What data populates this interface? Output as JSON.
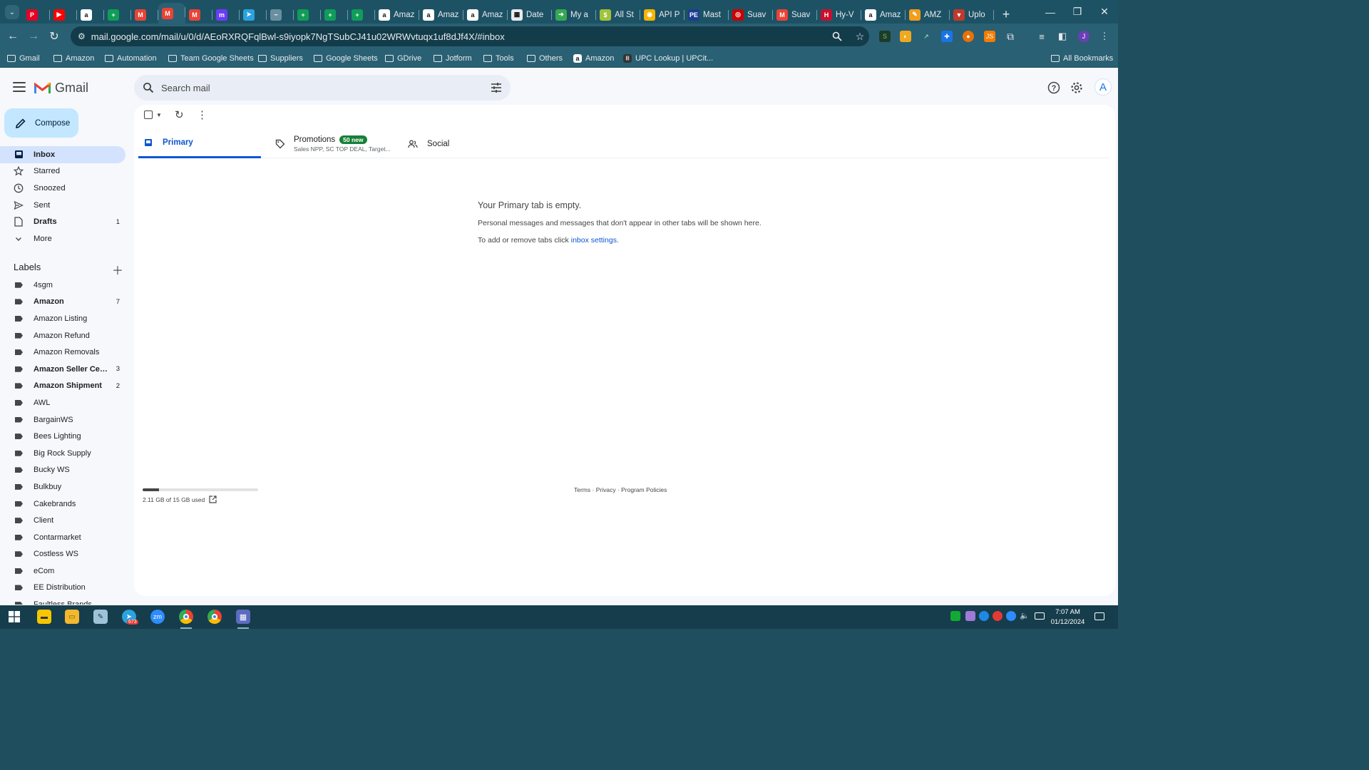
{
  "browser": {
    "tabs": [
      {
        "title": "",
        "icon": "pinterest-icon",
        "color": "#e60023",
        "glyph": "P"
      },
      {
        "title": "",
        "icon": "youtube-icon",
        "color": "#ff0000",
        "glyph": "▶"
      },
      {
        "title": "",
        "icon": "amazon-icon",
        "color": "#ffffff",
        "glyph": "a"
      },
      {
        "title": "",
        "icon": "google-sheets-icon",
        "color": "#0f9d58",
        "glyph": "+"
      },
      {
        "title": "",
        "icon": "gmail-icon",
        "color": "#ea4335",
        "glyph": "M"
      },
      {
        "title": "",
        "icon": "gmail-icon",
        "color": "#ea4335",
        "glyph": "M",
        "active": true
      },
      {
        "title": "",
        "icon": "gmail-icon",
        "color": "#ea4335",
        "glyph": "M"
      },
      {
        "title": "",
        "icon": "messenger-icon",
        "color": "#6b3cf7",
        "glyph": "m"
      },
      {
        "title": "",
        "icon": "telegram-icon",
        "color": "#2aa3df",
        "glyph": "➤"
      },
      {
        "title": "",
        "icon": "analytics-icon",
        "color": "#6b8fa0",
        "glyph": "~"
      },
      {
        "title": "",
        "icon": "google-sheets-icon",
        "color": "#0f9d58",
        "glyph": "+"
      },
      {
        "title": "",
        "icon": "google-sheets-icon",
        "color": "#0f9d58",
        "glyph": "+"
      },
      {
        "title": "",
        "icon": "google-sheets-icon",
        "color": "#0f9d58",
        "glyph": "+"
      },
      {
        "title": "Amaz",
        "icon": "amazon-icon",
        "color": "#ffffff",
        "glyph": "a"
      },
      {
        "title": "Amaz",
        "icon": "amazon-icon",
        "color": "#ffffff",
        "glyph": "a"
      },
      {
        "title": "Amaz",
        "icon": "amazon-icon",
        "color": "#ffffff",
        "glyph": "a"
      },
      {
        "title": "Date",
        "icon": "calendar-grid-icon",
        "color": "#e8eaed",
        "glyph": "▦"
      },
      {
        "title": "My a",
        "icon": "arrow-icon",
        "color": "#34a853",
        "glyph": "➔"
      },
      {
        "title": "All St",
        "icon": "store-icon",
        "color": "#9fc33b",
        "glyph": "$"
      },
      {
        "title": "API P",
        "icon": "api-icon",
        "color": "#f6b400",
        "glyph": "◉"
      },
      {
        "title": "Mast",
        "icon": "pe-icon",
        "color": "#1a3d8f",
        "glyph": "PE"
      },
      {
        "title": "Suav",
        "icon": "target-icon",
        "color": "#cc0000",
        "glyph": "◎"
      },
      {
        "title": "Suav",
        "icon": "gmail-icon",
        "color": "#ea4335",
        "glyph": "M"
      },
      {
        "title": "Hy-V",
        "icon": "hyvee-icon",
        "color": "#c8102e",
        "glyph": "H"
      },
      {
        "title": "Amaz",
        "icon": "amazon-icon",
        "color": "#ffffff",
        "glyph": "a"
      },
      {
        "title": "AMZ",
        "icon": "feather-icon",
        "color": "#f29d1b",
        "glyph": "✎"
      },
      {
        "title": "Uplo",
        "icon": "upload-icon",
        "color": "#c0392b",
        "glyph": "▼"
      }
    ],
    "url": "mail.google.com/mail/u/0/d/AEoRXRQFqlBwl-s9iyopk7NgTSubCJ41u02WRWvtuqx1uf8dJf4X/#inbox",
    "bookmarks": [
      {
        "label": "Gmail",
        "icon": "folder-icon"
      },
      {
        "label": "Amazon",
        "icon": "folder-icon"
      },
      {
        "label": "Automation",
        "icon": "folder-icon"
      },
      {
        "label": "Team Google Sheets",
        "icon": "folder-icon"
      },
      {
        "label": "Suppliers",
        "icon": "folder-icon"
      },
      {
        "label": "Google Sheets",
        "icon": "folder-icon"
      },
      {
        "label": "GDrive",
        "icon": "folder-icon"
      },
      {
        "label": "Jotform",
        "icon": "folder-icon"
      },
      {
        "label": "Tools",
        "icon": "folder-icon"
      },
      {
        "label": "Others",
        "icon": "folder-icon"
      },
      {
        "label": "Amazon",
        "icon": "amazon-icon"
      },
      {
        "label": "UPC Lookup | UPCit...",
        "icon": "barcode-icon"
      }
    ],
    "all_bookmarks": "All Bookmarks",
    "profile_initial": "J"
  },
  "gmail": {
    "product_name": "Gmail",
    "search_placeholder": "Search mail",
    "compose_label": "Compose",
    "avatar_initial": "A",
    "nav": [
      {
        "label": "Inbox",
        "icon": "inbox-icon",
        "active": true,
        "count": ""
      },
      {
        "label": "Starred",
        "icon": "star-icon",
        "count": ""
      },
      {
        "label": "Snoozed",
        "icon": "clock-icon",
        "count": ""
      },
      {
        "label": "Sent",
        "icon": "send-icon",
        "count": ""
      },
      {
        "label": "Drafts",
        "icon": "draft-icon",
        "count": "1",
        "bold": true
      },
      {
        "label": "More",
        "icon": "chevron-down-icon",
        "count": ""
      }
    ],
    "labels_title": "Labels",
    "labels": [
      {
        "label": "4sgm",
        "count": ""
      },
      {
        "label": "Amazon",
        "count": "7",
        "bold": true
      },
      {
        "label": "Amazon Listing",
        "count": ""
      },
      {
        "label": "Amazon Refund",
        "count": ""
      },
      {
        "label": "Amazon Removals",
        "count": ""
      },
      {
        "label": "Amazon Seller Cen...",
        "count": "3",
        "bold": true
      },
      {
        "label": "Amazon Shipment",
        "count": "2",
        "bold": true
      },
      {
        "label": "AWL",
        "count": ""
      },
      {
        "label": "BargainWS",
        "count": ""
      },
      {
        "label": "Bees Lighting",
        "count": ""
      },
      {
        "label": "Big Rock Supply",
        "count": ""
      },
      {
        "label": "Bucky WS",
        "count": ""
      },
      {
        "label": "Bulkbuy",
        "count": ""
      },
      {
        "label": "Cakebrands",
        "count": ""
      },
      {
        "label": "Client",
        "count": ""
      },
      {
        "label": "Contarmarket",
        "count": ""
      },
      {
        "label": "Costless WS",
        "count": ""
      },
      {
        "label": "eCom",
        "count": ""
      },
      {
        "label": "EE Distribution",
        "count": ""
      },
      {
        "label": "Faultless Brands",
        "count": ""
      }
    ],
    "tabs": {
      "primary": "Primary",
      "promotions": "Promotions",
      "promotions_badge": "50 new",
      "promotions_sub": "Sales NPP, SC TOP DEAL, Target...",
      "social": "Social"
    },
    "empty": {
      "title": "Your Primary tab is empty.",
      "line1": "Personal messages and messages that don't appear in other tabs will be shown here.",
      "line2_prefix": "To add or remove tabs click ",
      "line2_link": "inbox settings",
      "line2_suffix": "."
    },
    "storage": {
      "text": "2.11 GB of 15 GB used",
      "used_fraction": 0.14
    },
    "footer": {
      "terms": "Terms",
      "privacy": "Privacy",
      "policies": "Program Policies",
      "sep": " · "
    }
  },
  "taskbar": {
    "telegram_badge": "673",
    "time": "7:07 AM",
    "date": "01/12/2024"
  }
}
